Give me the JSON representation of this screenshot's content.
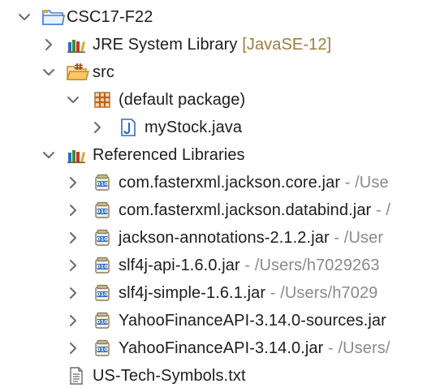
{
  "tree": {
    "project": {
      "label": "CSC17-F22",
      "icon": "project-folder-icon",
      "expanded": true
    },
    "jre": {
      "label": "JRE System Library",
      "decoration": "[JavaSE-12]",
      "icon": "library-icon",
      "expanded": false
    },
    "src": {
      "label": "src",
      "icon": "source-folder-icon",
      "expanded": true
    },
    "default_package": {
      "label": "(default package)",
      "icon": "package-icon",
      "expanded": true
    },
    "mystock": {
      "label": "myStock.java",
      "icon": "java-file-icon",
      "expanded": false
    },
    "ref_libs": {
      "label": "Referenced Libraries",
      "icon": "library-icon",
      "expanded": true
    },
    "jars": [
      {
        "label": "com.fasterxml.jackson.core.jar",
        "path": " - /Use"
      },
      {
        "label": "com.fasterxml.jackson.databind.jar",
        "path": " - /"
      },
      {
        "label": "jackson-annotations-2.1.2.jar",
        "path": " - /User"
      },
      {
        "label": "slf4j-api-1.6.0.jar",
        "path": " - /Users/h7029263"
      },
      {
        "label": "slf4j-simple-1.6.1.jar",
        "path": " - /Users/h7029"
      },
      {
        "label": "YahooFinanceAPI-3.14.0-sources.jar",
        "path": ""
      },
      {
        "label": "YahooFinanceAPI-3.14.0.jar",
        "path": " - /Users/"
      }
    ],
    "text_file": {
      "label": "US-Tech-Symbols.txt",
      "icon": "text-file-icon"
    }
  },
  "colors": {
    "text": "#1d1d1d",
    "decoration": "#9e7b3f",
    "path": "#8a8a8a",
    "chevron": "#6b6b6b",
    "java_blue": "#2b6cc4",
    "folder_orange": "#e8a33a",
    "package_brown": "#b5651d"
  }
}
